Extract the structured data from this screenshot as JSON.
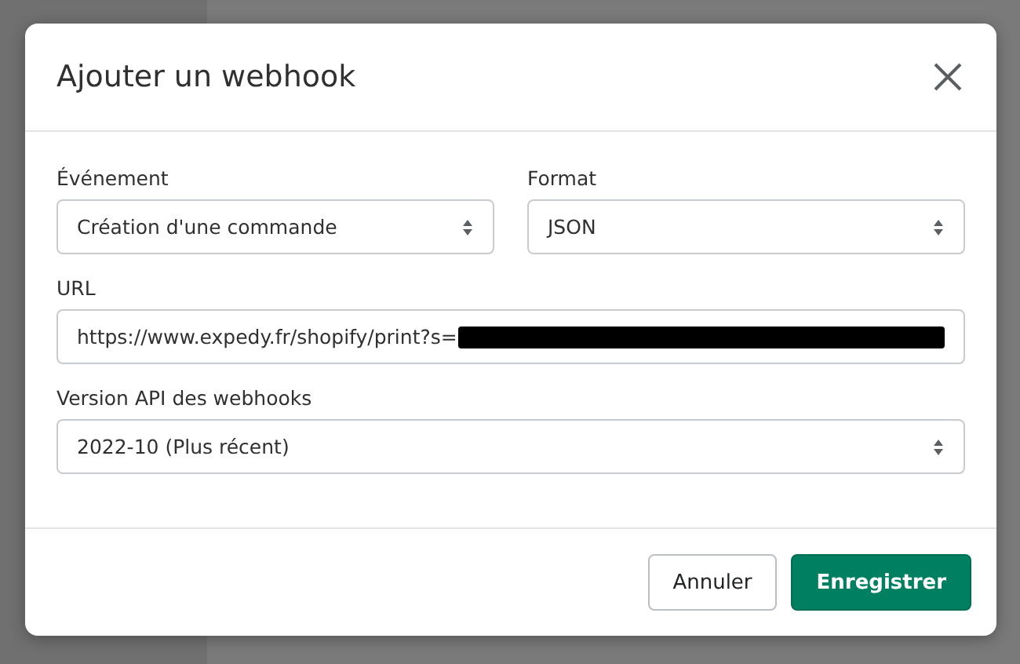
{
  "dialog": {
    "title": "Ajouter un webhook",
    "fields": [
      {
        "kind": "select",
        "label": "Événement",
        "value": "Création d'une commande"
      },
      {
        "kind": "select",
        "label": "Format",
        "value": "JSON"
      },
      {
        "kind": "text",
        "label": "URL",
        "value": "https://www.expedy.fr/shopify/print?s=",
        "redacted": true
      },
      {
        "kind": "select",
        "label": "Version API des webhooks",
        "value": "2022-10 (Plus récent)"
      }
    ],
    "buttons": [
      {
        "kind": "secondary",
        "label": "Annuler"
      },
      {
        "kind": "primary",
        "label": "Enregistrer"
      }
    ]
  }
}
